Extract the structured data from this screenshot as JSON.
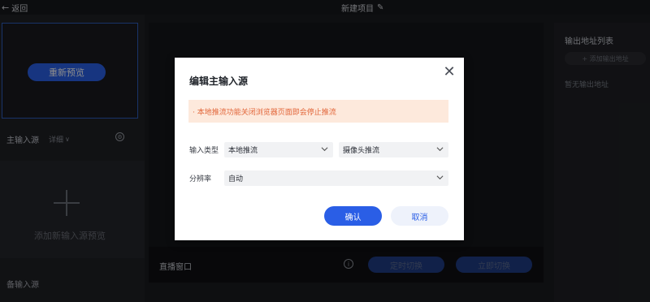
{
  "topbar": {
    "back_label": "返回",
    "project_title": "新建项目"
  },
  "left_panel": {
    "repreview_button": "重新预览",
    "main_input_label": "主输入源",
    "detail_label": "详细",
    "add_input_label": "添加新输入源预览",
    "backup_input_label": "备输入源"
  },
  "center": {
    "live_window_label": "直播窗口",
    "timed_switch_button": "定时切换",
    "switch_now_button": "立即切换"
  },
  "right_panel": {
    "output_list_title": "输出地址列表",
    "add_output_button": "+ 添加输出地址",
    "no_output_text": "暂无输出地址"
  },
  "modal": {
    "title": "编辑主输入源",
    "warning": "· 本地推流功能关闭浏览器页面即会停止推流",
    "input_type_label": "输入类型",
    "input_type_value": "本地推流",
    "camera_value": "摄像头推流",
    "resolution_label": "分辨率",
    "resolution_value": "自动",
    "confirm_button": "确认",
    "cancel_button": "取消"
  },
  "colors": {
    "accent": "#2a5ee6",
    "warning_bg": "#fde9dc",
    "warning_text": "#e2663a",
    "app_bg": "#1b1c20"
  }
}
